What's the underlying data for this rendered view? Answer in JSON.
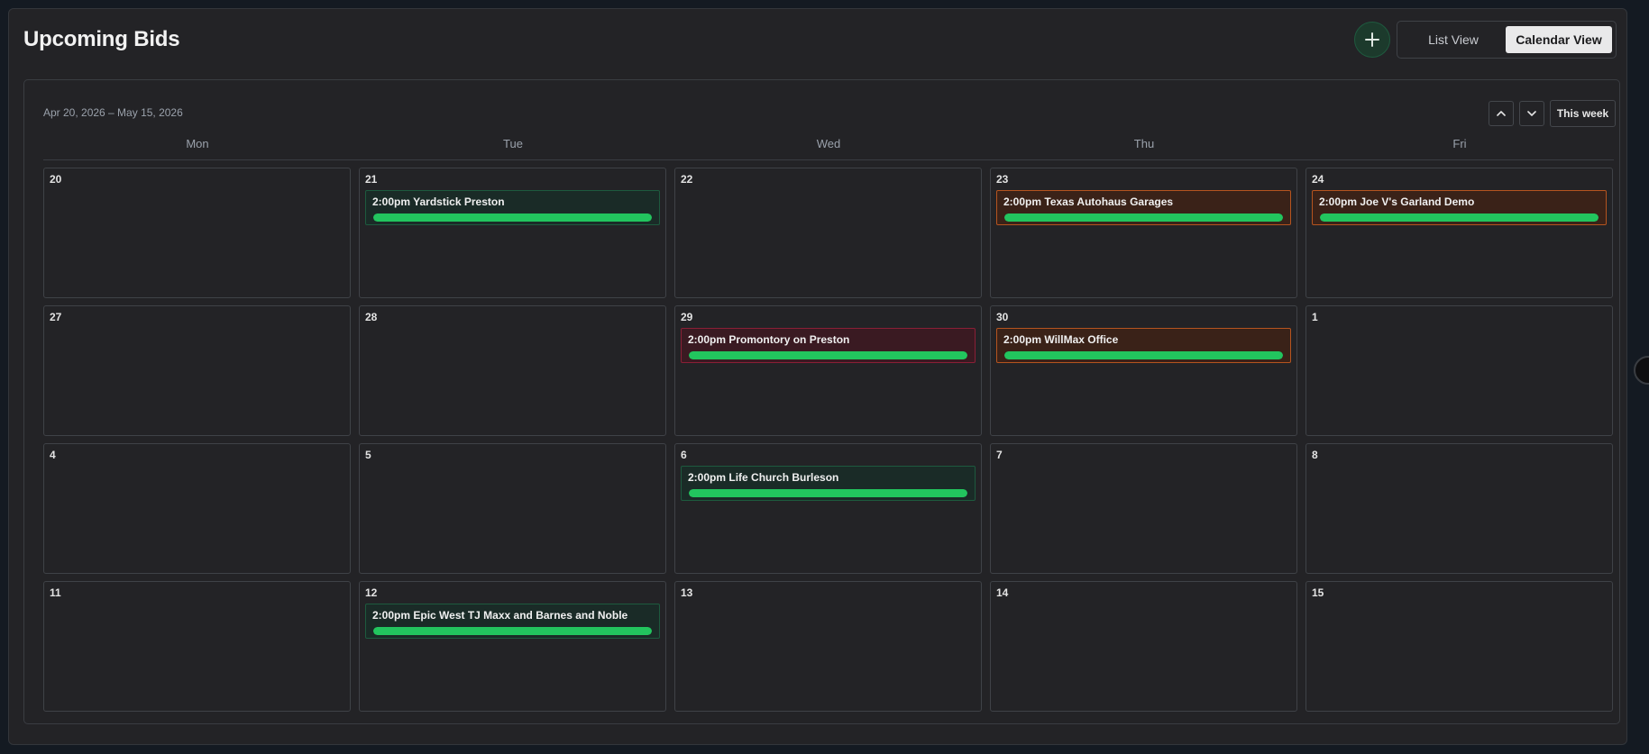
{
  "header": {
    "title": "Upcoming Bids",
    "add_icon": "plus-icon",
    "view_toggle": {
      "list_label": "List View",
      "calendar_label": "Calendar View",
      "selected": "Calendar View"
    }
  },
  "calendar": {
    "range_label": "Apr 20, 2026 – May 15, 2026",
    "nav_up_icon": "chevron-up-icon",
    "nav_down_icon": "chevron-down-icon",
    "this_week_label": "This week",
    "weekdays": [
      "Mon",
      "Tue",
      "Wed",
      "Thu",
      "Fri"
    ],
    "weeks": [
      [
        {
          "day": "20",
          "events": []
        },
        {
          "day": "21",
          "events": [
            {
              "time": "2:00pm",
              "name": "Yardstick Preston",
              "status": "green",
              "progress": 1.0
            }
          ]
        },
        {
          "day": "22",
          "events": []
        },
        {
          "day": "23",
          "events": [
            {
              "time": "2:00pm",
              "name": "Texas Autohaus Garages",
              "status": "orange",
              "progress": 1.0
            }
          ]
        },
        {
          "day": "24",
          "events": [
            {
              "time": "2:00pm",
              "name": "Joe V's Garland Demo",
              "status": "orange",
              "progress": 1.0
            }
          ]
        }
      ],
      [
        {
          "day": "27",
          "events": []
        },
        {
          "day": "28",
          "events": []
        },
        {
          "day": "29",
          "events": [
            {
              "time": "2:00pm",
              "name": "Promontory on Preston",
              "status": "red",
              "progress": 1.0
            }
          ]
        },
        {
          "day": "30",
          "events": [
            {
              "time": "2:00pm",
              "name": "WillMax Office",
              "status": "orange",
              "progress": 1.0
            }
          ]
        },
        {
          "day": "1",
          "events": []
        }
      ],
      [
        {
          "day": "4",
          "events": []
        },
        {
          "day": "5",
          "events": []
        },
        {
          "day": "6",
          "events": [
            {
              "time": "2:00pm",
              "name": "Life Church Burleson",
              "status": "green",
              "progress": 1.0
            }
          ]
        },
        {
          "day": "7",
          "events": []
        },
        {
          "day": "8",
          "events": []
        }
      ],
      [
        {
          "day": "11",
          "events": []
        },
        {
          "day": "12",
          "events": [
            {
              "time": "2:00pm",
              "name": "Epic West TJ Maxx and Barnes and Noble",
              "status": "green",
              "progress": 1.0
            }
          ]
        },
        {
          "day": "13",
          "events": []
        },
        {
          "day": "14",
          "events": []
        },
        {
          "day": "15",
          "events": []
        }
      ]
    ]
  },
  "colors": {
    "progress": "#22c55e",
    "status_green_border": "#1d5a3e",
    "status_orange_border": "#b5541f",
    "status_red_border": "#8a1f36"
  }
}
